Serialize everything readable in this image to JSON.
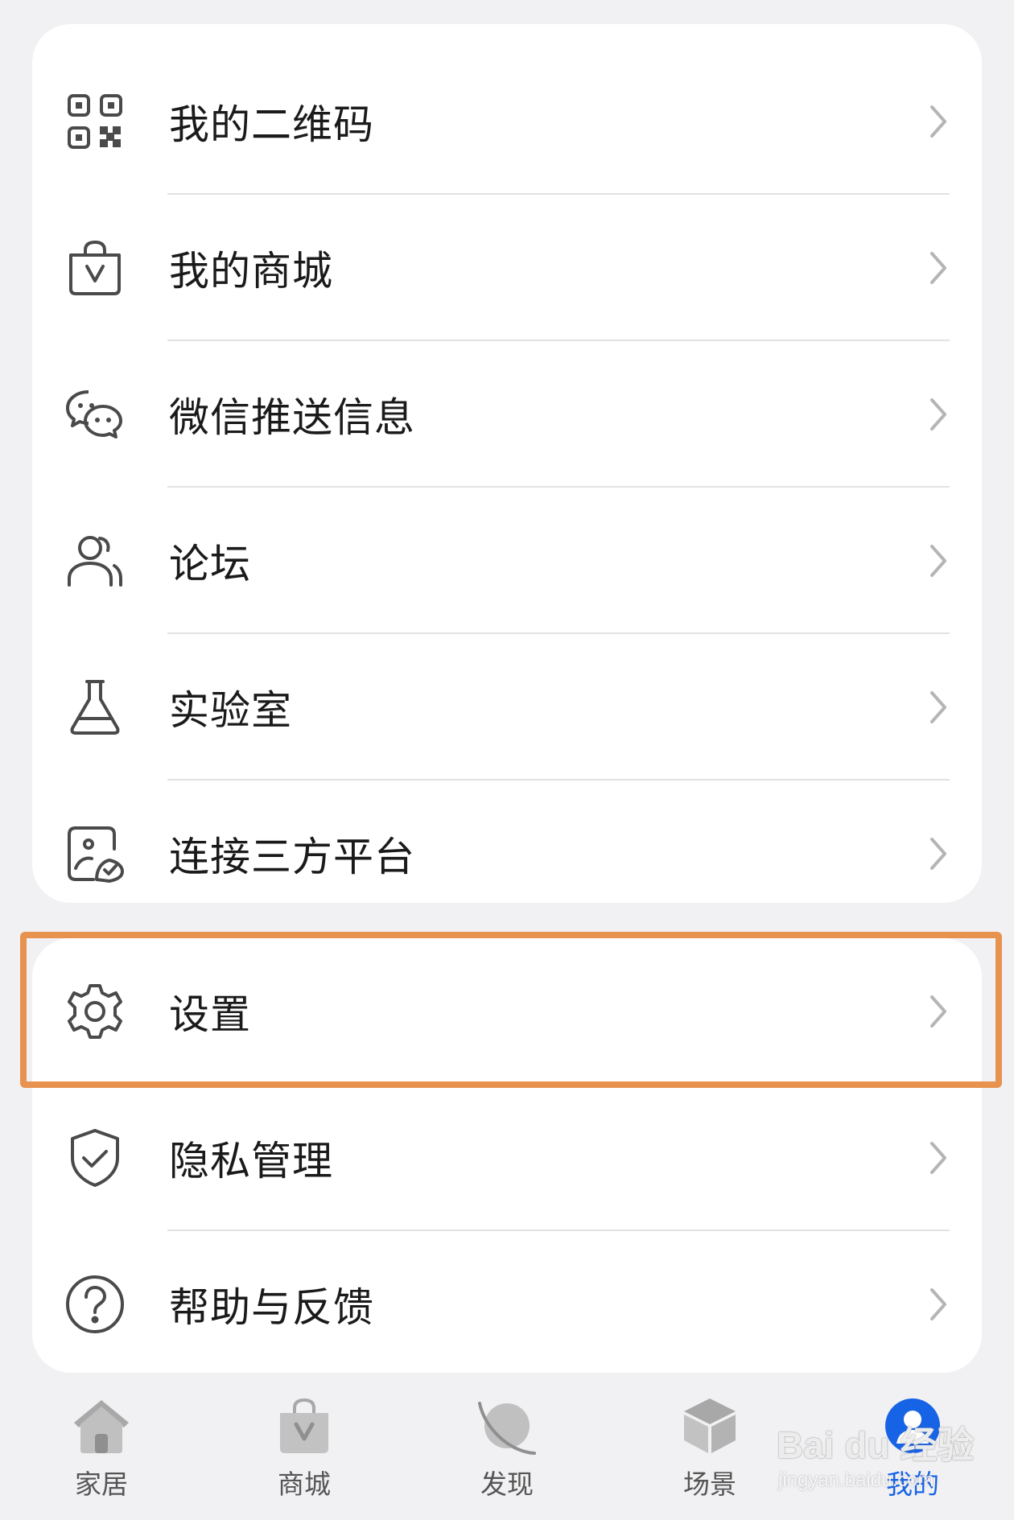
{
  "menu_group_1": [
    {
      "label": "我的二维码",
      "icon": "qr-code-icon"
    },
    {
      "label": "我的商城",
      "icon": "shopping-bag-icon"
    },
    {
      "label": "微信推送信息",
      "icon": "wechat-icon"
    },
    {
      "label": "论坛",
      "icon": "forum-users-icon"
    },
    {
      "label": "实验室",
      "icon": "flask-icon"
    },
    {
      "label": "连接三方平台",
      "icon": "third-party-icon"
    }
  ],
  "menu_group_2": [
    {
      "label": "设置",
      "icon": "gear-icon"
    },
    {
      "label": "隐私管理",
      "icon": "shield-check-icon"
    },
    {
      "label": "帮助与反馈",
      "icon": "help-circle-icon"
    }
  ],
  "tabbar": [
    {
      "label": "家居",
      "icon": "home-icon",
      "active": false
    },
    {
      "label": "商城",
      "icon": "mall-bag-icon",
      "active": false
    },
    {
      "label": "发现",
      "icon": "planet-icon",
      "active": false
    },
    {
      "label": "场景",
      "icon": "cube-icon",
      "active": false
    },
    {
      "label": "我的",
      "icon": "profile-icon",
      "active": true
    }
  ],
  "watermark": {
    "logo": "Bai du 经验",
    "url": "jingyan.baidu.com"
  },
  "colors": {
    "highlight_border": "#e8924f",
    "active_tab": "#1763e6",
    "background": "#f1f1f3",
    "card": "#ffffff"
  }
}
